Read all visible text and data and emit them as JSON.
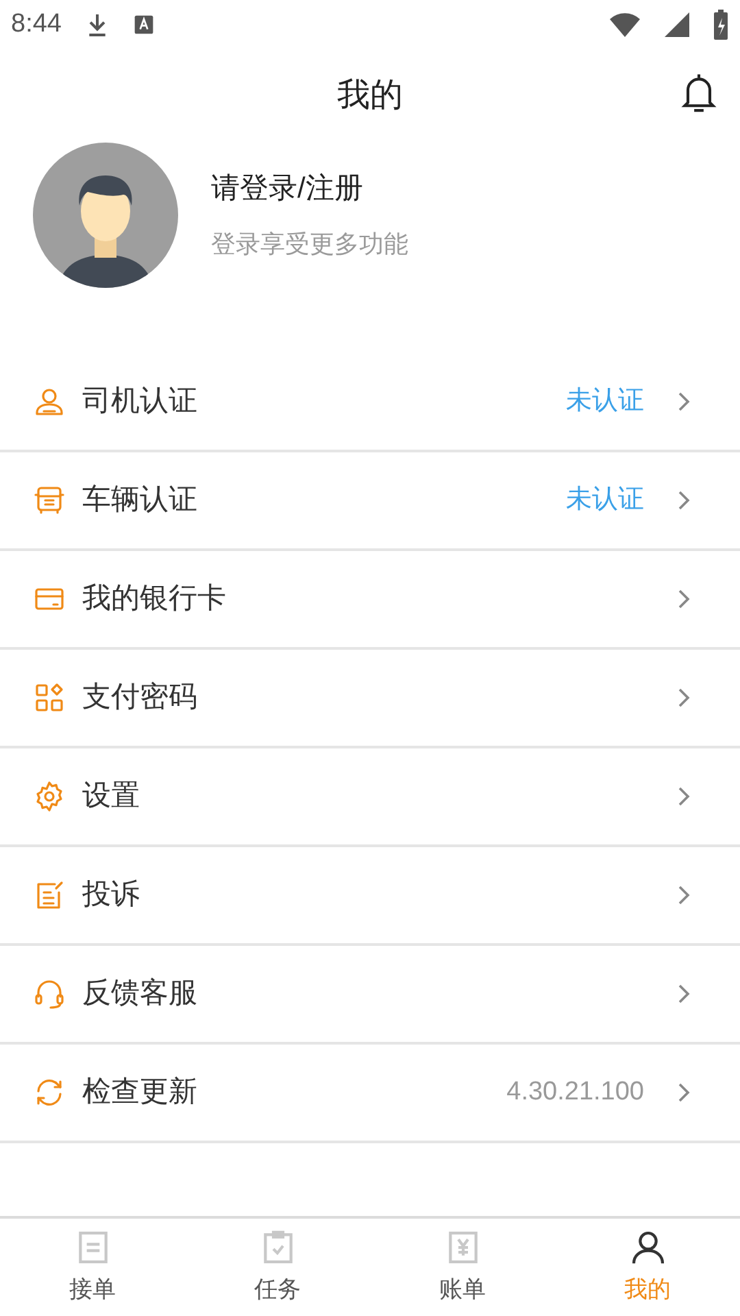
{
  "status_bar": {
    "time": "8:44"
  },
  "header": {
    "title": "我的"
  },
  "profile": {
    "name": "请登录/注册",
    "subtitle": "登录享受更多功能"
  },
  "menu": [
    {
      "label": "司机认证",
      "kind": "status",
      "value": "未认证"
    },
    {
      "label": "车辆认证",
      "kind": "status",
      "value": "未认证"
    },
    {
      "label": "我的银行卡",
      "kind": "plain"
    },
    {
      "label": "支付密码",
      "kind": "plain"
    },
    {
      "label": "设置",
      "kind": "plain"
    },
    {
      "label": "投诉",
      "kind": "plain"
    },
    {
      "label": "反馈客服",
      "kind": "plain"
    },
    {
      "label": "检查更新",
      "kind": "version",
      "value": "4.30.21.100"
    }
  ],
  "tabs": [
    {
      "label": "接单",
      "selected": false
    },
    {
      "label": "任务",
      "selected": false
    },
    {
      "label": "账单",
      "selected": false
    },
    {
      "label": "我的",
      "selected": true
    }
  ]
}
